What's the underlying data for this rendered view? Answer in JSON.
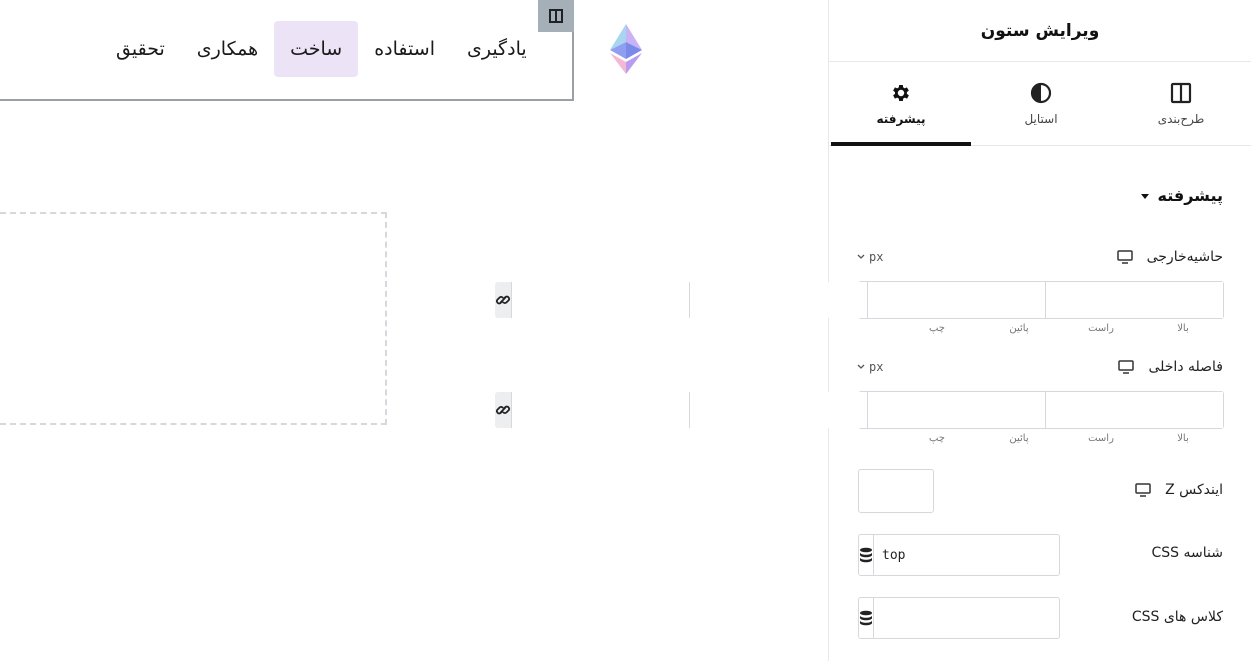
{
  "nav": {
    "items": [
      {
        "label": "یادگیری"
      },
      {
        "label": "استفاده"
      },
      {
        "label": "ساخت",
        "active": true
      },
      {
        "label": "همکاری"
      },
      {
        "label": "تحقیق"
      }
    ]
  },
  "panel": {
    "title": "ویرایش ستون",
    "tabs": [
      {
        "label": "طرح‌بندی",
        "icon": "columns-icon"
      },
      {
        "label": "استایل",
        "icon": "contrast-icon"
      },
      {
        "label": "پیشرفته",
        "icon": "gear-icon",
        "active": true
      }
    ],
    "section": {
      "title": "پیشرفته"
    },
    "margin": {
      "label": "حاشیه‌خارجی",
      "unit": "px",
      "sides": [
        "بالا",
        "راست",
        "پائین",
        "چپ"
      ]
    },
    "padding": {
      "label": "فاصله داخلی",
      "unit": "px",
      "sides": [
        "بالا",
        "راست",
        "پائین",
        "چپ"
      ]
    },
    "z_index": {
      "label": "ایندکس Z",
      "value": ""
    },
    "css_id": {
      "label": "شناسه CSS",
      "value": "top"
    },
    "css_classes": {
      "label": "کلاس های CSS",
      "value": ""
    }
  },
  "colors": {
    "accent": "#111111",
    "active_nav_bg": "#ece3f6",
    "handle_bg": "#a4afb7"
  }
}
